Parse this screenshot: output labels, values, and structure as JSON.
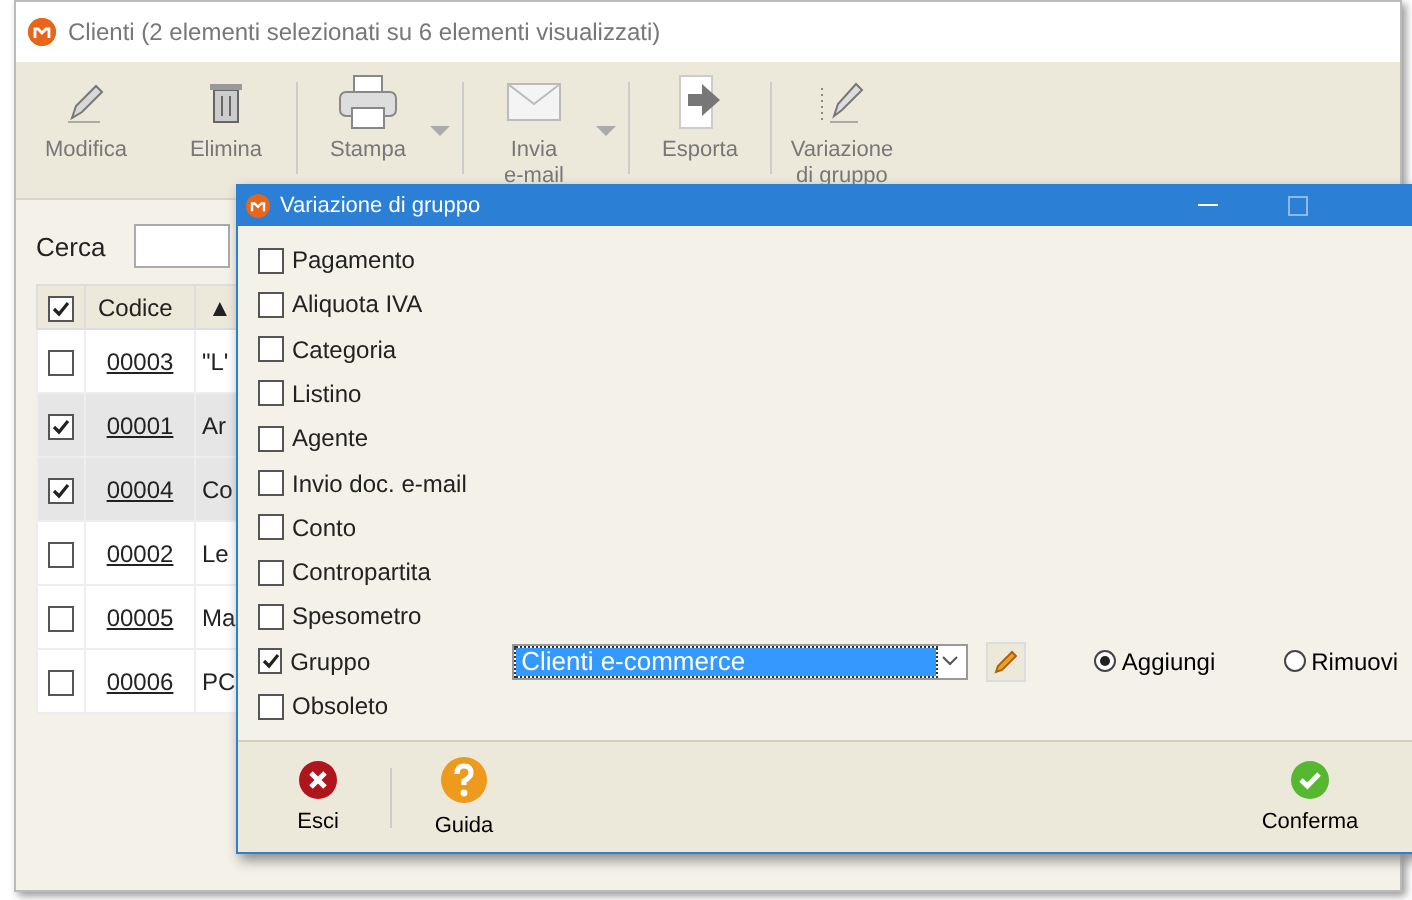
{
  "window": {
    "title": "Clienti (2 elementi selezionati su 6 elementi visualizzati)"
  },
  "toolbar": [
    {
      "label": "Modifica",
      "kind": "edit",
      "dropdown": false
    },
    {
      "label": "Elimina",
      "kind": "delete",
      "dropdown": false
    },
    {
      "label": "Stampa",
      "kind": "print",
      "dropdown": true
    },
    {
      "label": "Invia\ne-mail",
      "kind": "email",
      "dropdown": true
    },
    {
      "label": "Esporta",
      "kind": "export",
      "dropdown": false
    },
    {
      "label": "Variazione\ndi gruppo",
      "kind": "group",
      "dropdown": false
    }
  ],
  "search": {
    "label": "Cerca"
  },
  "table": {
    "header_checked": true,
    "columns": [
      "Codice",
      "▲"
    ],
    "rows": [
      {
        "checked": false,
        "code": "00003",
        "name": "\"L'"
      },
      {
        "checked": true,
        "code": "00001",
        "name": "Ar"
      },
      {
        "checked": true,
        "code": "00004",
        "name": "Co"
      },
      {
        "checked": false,
        "code": "00002",
        "name": "Le"
      },
      {
        "checked": false,
        "code": "00005",
        "name": "Ma"
      },
      {
        "checked": false,
        "code": "00006",
        "name": "PC"
      }
    ]
  },
  "dialog": {
    "title": "Variazione di gruppo",
    "options": [
      {
        "label": "Pagamento",
        "checked": false
      },
      {
        "label": "Aliquota IVA",
        "checked": false
      },
      {
        "label": "Categoria",
        "checked": false
      },
      {
        "label": "Listino",
        "checked": false
      },
      {
        "label": "Agente",
        "checked": false
      },
      {
        "label": "Invio doc. e-mail",
        "checked": false
      },
      {
        "label": "Conto",
        "checked": false
      },
      {
        "label": "Contropartita",
        "checked": false
      },
      {
        "label": "Spesometro",
        "checked": false
      },
      {
        "label": "Gruppo",
        "checked": true,
        "kind": "select",
        "value": "Clienti e-commerce",
        "radios": [
          {
            "label": "Aggiungi",
            "selected": true
          },
          {
            "label": "Rimuovi",
            "selected": false
          }
        ]
      },
      {
        "label": "Obsoleto",
        "checked": false
      }
    ],
    "footer": [
      {
        "label": "Esci",
        "kind": "exit"
      },
      {
        "label": "Guida",
        "kind": "help"
      },
      {
        "label": "Conferma",
        "kind": "confirm"
      }
    ]
  }
}
